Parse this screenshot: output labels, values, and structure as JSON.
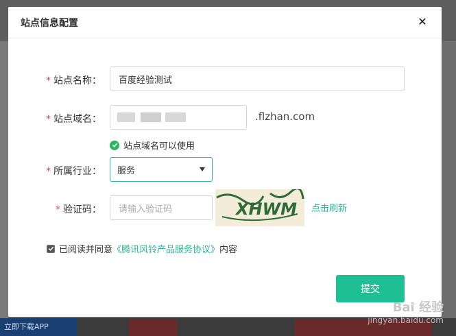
{
  "modal": {
    "title": "站点信息配置",
    "close_symbol": "✕"
  },
  "form": {
    "site_name": {
      "label": "站点名称：",
      "value": "百度经验测试"
    },
    "site_domain": {
      "label": "站点域名：",
      "suffix": ".flzhan.com",
      "status": "站点域名可以使用"
    },
    "industry": {
      "label": "所属行业：",
      "selected": "服务"
    },
    "captcha": {
      "label": "验证码：",
      "placeholder": "请输入验证码",
      "image_text": "XHWM",
      "refresh_label": "点击刷新"
    },
    "agreement": {
      "prefix": "已阅读并同意",
      "link_text": "《腾讯风铃产品服务协议》",
      "suffix": "内容",
      "checked": true
    },
    "submit_label": "提交",
    "required_mark": "*"
  },
  "background": {
    "app_button": "立即下载APP"
  },
  "watermark": {
    "logo": "Bai 经验",
    "url": "jingyan.baidu.com"
  },
  "colors": {
    "accent": "#1fbf95",
    "required": "#e64545",
    "success": "#2bb55e"
  }
}
